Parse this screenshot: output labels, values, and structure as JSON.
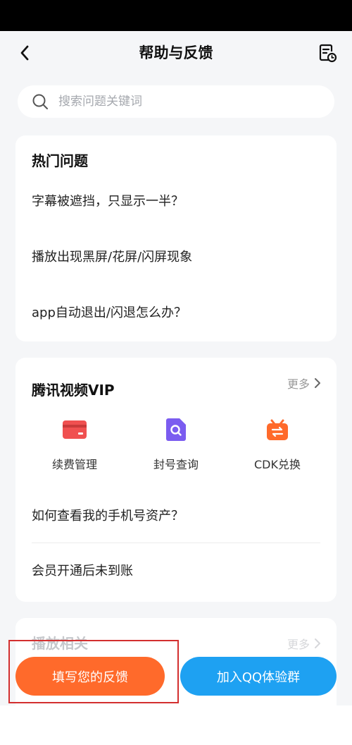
{
  "header": {
    "title": "帮助与反馈"
  },
  "search": {
    "placeholder": "搜索问题关键词"
  },
  "hot": {
    "title": "热门问题",
    "items": [
      "字幕被遮挡，只显示一半？",
      "播放出现黑屏/花屏/闪屏现象",
      "app自动退出/闪退怎么办？"
    ]
  },
  "vip": {
    "title": "腾讯视频VIP",
    "more": "更多",
    "actions": [
      {
        "label": "续费管理",
        "icon": "card-icon",
        "color": "#f05050"
      },
      {
        "label": "封号查询",
        "icon": "search-doc-icon",
        "color": "#7b5cf0"
      },
      {
        "label": "CDK兑换",
        "icon": "exchange-icon",
        "color": "#ff6a2b"
      }
    ],
    "items": [
      "如何查看我的手机号资产？",
      "会员开通后未到账"
    ]
  },
  "playback": {
    "title": "播放相关",
    "more": "更多"
  },
  "buttons": {
    "feedback": "填写您的反馈",
    "qq_group": "加入QQ体验群"
  },
  "colors": {
    "accent_orange": "#ff6a2b",
    "accent_blue": "#1ea1f2",
    "highlight": "#d32f2f"
  }
}
